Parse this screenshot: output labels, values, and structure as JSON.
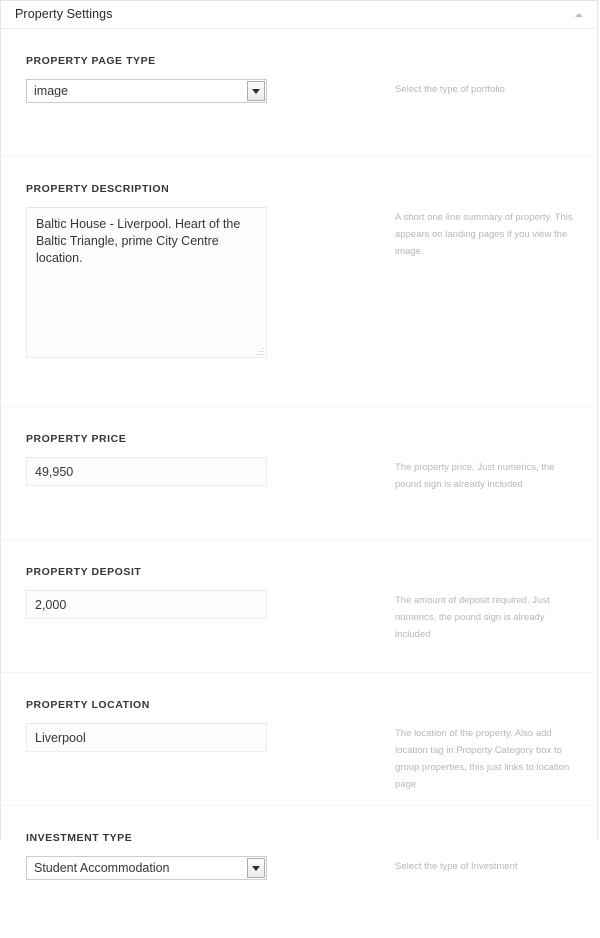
{
  "panel": {
    "title": "Property Settings",
    "toggle_icon": "caret-up-icon"
  },
  "fields": [
    {
      "key": "property_page_type",
      "label": "PROPERTY PAGE TYPE",
      "type": "select",
      "value": "image",
      "help": "Select the type of portfolio."
    },
    {
      "key": "property_description",
      "label": "PROPERTY DESCRIPTION",
      "type": "textarea",
      "value": "Baltic House - Liverpool. Heart of the Baltic Triangle, prime City Centre location.",
      "help": "A short one line summary of property. This appears on landing pages if you view the image."
    },
    {
      "key": "property_price",
      "label": "PROPERTY PRICE",
      "type": "text",
      "value": "49,950",
      "help": "The property price. Just numerics, the pound sign is already included"
    },
    {
      "key": "property_deposit",
      "label": "PROPERTY DEPOSIT",
      "type": "text",
      "value": "2,000",
      "help": "The amount of deposit required. Just numerics, the pound sign is already included"
    },
    {
      "key": "property_location",
      "label": "PROPERTY LOCATION",
      "type": "text",
      "value": "Liverpool",
      "help": "The location of the property. Also add location tag in Property Category box to group properties, this just links to location page"
    },
    {
      "key": "investment_type",
      "label": "INVESTMENT TYPE",
      "type": "select",
      "value": "Student Accommodation",
      "help": "Select the type of Investment"
    }
  ],
  "colors": {
    "panel_border": "#e3e5e8",
    "label_text": "#32373c",
    "help_text": "#b4b8bd",
    "input_bg": "#fcfcfc",
    "select_border": "#c9ccd1"
  }
}
